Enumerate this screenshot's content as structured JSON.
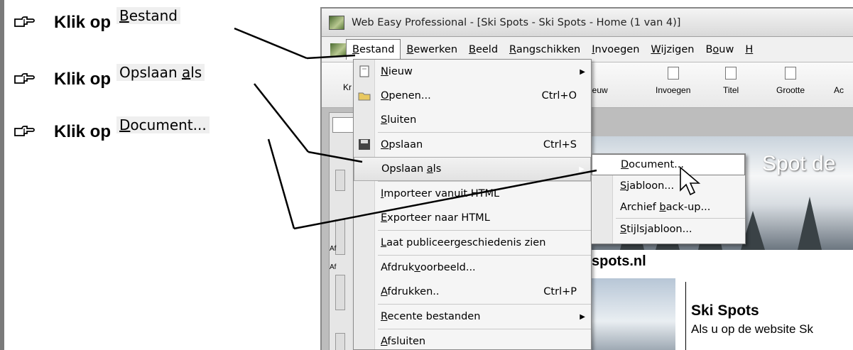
{
  "instructions": [
    {
      "prefix": "Klik op",
      "target": "Bestand",
      "underline_index": 0
    },
    {
      "prefix": "Klik op",
      "target": "Opslaan als",
      "underline_index": 8
    },
    {
      "prefix": "Klik op",
      "target": "Document...",
      "underline_index": 0
    }
  ],
  "window": {
    "title": "Web Easy Professional - [Ski Spots - Ski Spots - Home (1 van 4)]"
  },
  "menubar": [
    "Bestand",
    "Bewerken",
    "Beeld",
    "Rangschikken",
    "Invoegen",
    "Wijzigen",
    "Bouw",
    "H"
  ],
  "toolbar": {
    "left_label": "Kr",
    "buttons": [
      "ieuw",
      "Invoegen",
      "Titel",
      "Grootte",
      "Ac"
    ]
  },
  "file_menu": {
    "items": [
      {
        "label": "Nieuw",
        "shortcut": "",
        "submenu": true
      },
      {
        "label": "Openen...",
        "shortcut": "Ctrl+O",
        "submenu": false
      },
      {
        "label": "Sluiten",
        "shortcut": "",
        "submenu": false
      },
      {
        "label": "Opslaan",
        "shortcut": "Ctrl+S",
        "submenu": false
      },
      {
        "label": "Opslaan als",
        "shortcut": "",
        "submenu": true
      },
      {
        "label": "Importeer vanuit HTML",
        "shortcut": "",
        "submenu": false
      },
      {
        "label": "Exporteer naar HTML",
        "shortcut": "",
        "submenu": false
      },
      {
        "label": "Laat publiceergeschiedenis zien",
        "shortcut": "",
        "submenu": false
      },
      {
        "label": "Afdrukvoorbeeld...",
        "shortcut": "",
        "submenu": false
      },
      {
        "label": "Afdrukken..",
        "shortcut": "Ctrl+P",
        "submenu": false
      },
      {
        "label": "Recente bestanden",
        "shortcut": "",
        "submenu": true
      },
      {
        "label": "Afsluiten",
        "shortcut": "",
        "submenu": false
      }
    ]
  },
  "save_as_submenu": {
    "items": [
      "Document...",
      "Sjabloon...",
      "Archief back-up...",
      "Stijlsjabloon..."
    ]
  },
  "page_content": {
    "banner_text": "Spot de",
    "site_url": "spots.nl",
    "heading": "Ski Spots",
    "body_text": "Als u op de website Sk",
    "side_label_1": "Af",
    "side_label_2": "Af"
  }
}
